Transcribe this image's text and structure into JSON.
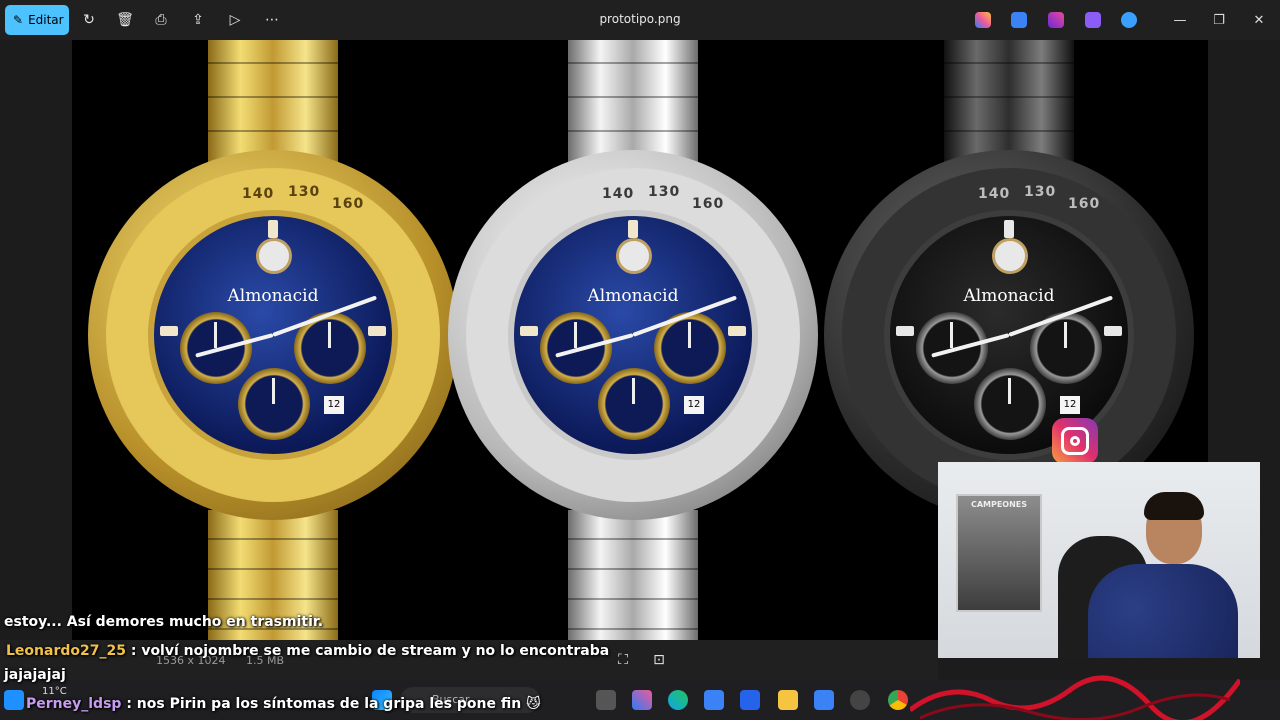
{
  "window": {
    "edit_label": "Editar",
    "filename": "prototipo.png"
  },
  "toolbar": {
    "icons": [
      "rotate-icon",
      "delete-icon",
      "print-icon",
      "share-icon",
      "slideshow-icon",
      "more-icon"
    ]
  },
  "watches": [
    {
      "brand": "Almonacid",
      "finish": "gold",
      "date": "12"
    },
    {
      "brand": "Almonacid",
      "finish": "silver",
      "date": "12"
    },
    {
      "brand": "Almonacid",
      "finish": "black",
      "date": "12"
    }
  ],
  "bezel_numbers": [
    "140",
    "130",
    "160"
  ],
  "webcam": {
    "poster_title": "CAMPEONES"
  },
  "chat": [
    {
      "user": "",
      "text": "estoy... Así demores mucho en trasmitir."
    },
    {
      "user": "Leonardo27_25",
      "text": ": volví nojombre se me cambio de stream y no lo encontraba"
    },
    {
      "user": "",
      "text": "jajajajaj"
    },
    {
      "user": "Perney_ldsp",
      "text": ": nos Pirin pa los síntomas de la gripa les pone fin 😼"
    }
  ],
  "file_info": {
    "dimensions": "1536 x 1024",
    "size": "1.5 MB"
  },
  "taskbar": {
    "temperature": "11°C",
    "search_placeholder": "Buscar"
  },
  "colors": {
    "accent": "#4cc2ff",
    "chat_user_1": "#f0c24a",
    "chat_user_2": "#c69cf0"
  }
}
